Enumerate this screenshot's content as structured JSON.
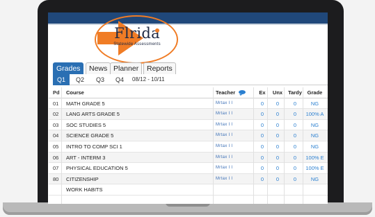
{
  "logo": {
    "word": "Flrida",
    "sub": "Statewide Assessments",
    "colors": {
      "accent": "#f07c25",
      "text": "#1f2a44"
    }
  },
  "tabs": [
    {
      "label": "Grades",
      "active": true
    },
    {
      "label": "News",
      "active": false
    },
    {
      "label": "Planner",
      "active": false
    },
    {
      "label": "Reports",
      "active": false
    }
  ],
  "quarters": [
    {
      "label": "Q1",
      "active": true
    },
    {
      "label": "Q2",
      "active": false
    },
    {
      "label": "Q3",
      "active": false
    },
    {
      "label": "Q4",
      "active": false
    }
  ],
  "date_range": "08/12 - 10/11",
  "table": {
    "headers": {
      "pd": "Pd",
      "course": "Course",
      "teacher": "Teacher",
      "ex": "Ex",
      "unx": "Unx",
      "tardy": "Tardy",
      "grade": "Grade"
    },
    "rows": [
      {
        "pd": "01",
        "course": "MATH GRADE 5",
        "teacher": "Mrtax I I",
        "ex": "0",
        "unx": "0",
        "tardy": "0",
        "grade": "NG"
      },
      {
        "pd": "02",
        "course": "LANG ARTS GRADE 5",
        "teacher": "Mrtax I I",
        "ex": "0",
        "unx": "0",
        "tardy": "0",
        "grade": "100% A"
      },
      {
        "pd": "03",
        "course": "SOC STUDIES 5",
        "teacher": "Mrtax I I",
        "ex": "0",
        "unx": "0",
        "tardy": "0",
        "grade": "NG"
      },
      {
        "pd": "04",
        "course": "SCIENCE GRADE 5",
        "teacher": "Mrtax I I",
        "ex": "0",
        "unx": "0",
        "tardy": "0",
        "grade": "NG"
      },
      {
        "pd": "05",
        "course": "INTRO TO COMP SCI 1",
        "teacher": "Mrtax I I",
        "ex": "0",
        "unx": "0",
        "tardy": "0",
        "grade": "NG"
      },
      {
        "pd": "06",
        "course": "ART - INTERM 3",
        "teacher": "Mrtax I I",
        "ex": "0",
        "unx": "0",
        "tardy": "0",
        "grade": "100% E"
      },
      {
        "pd": "07",
        "course": "PHYSICAL EDUCATION 5",
        "teacher": "Mrtax I I",
        "ex": "0",
        "unx": "0",
        "tardy": "0",
        "grade": "100% E"
      },
      {
        "pd": "80",
        "course": "CITIZENSHIP",
        "teacher": "Mrtax I I",
        "ex": "0",
        "unx": "0",
        "tardy": "0",
        "grade": "NG"
      },
      {
        "pd": "",
        "course": "WORK HABITS",
        "teacher": "",
        "ex": "",
        "unx": "",
        "tardy": "",
        "grade": ""
      }
    ]
  },
  "colors": {
    "tab_active": "#2a6fb3",
    "link": "#2a7fd0",
    "header_bar": "#20487a",
    "arrow": "#f07c25"
  },
  "icons": {
    "chat": "chat-bubble-icon",
    "arrow": "right-arrow-icon"
  }
}
